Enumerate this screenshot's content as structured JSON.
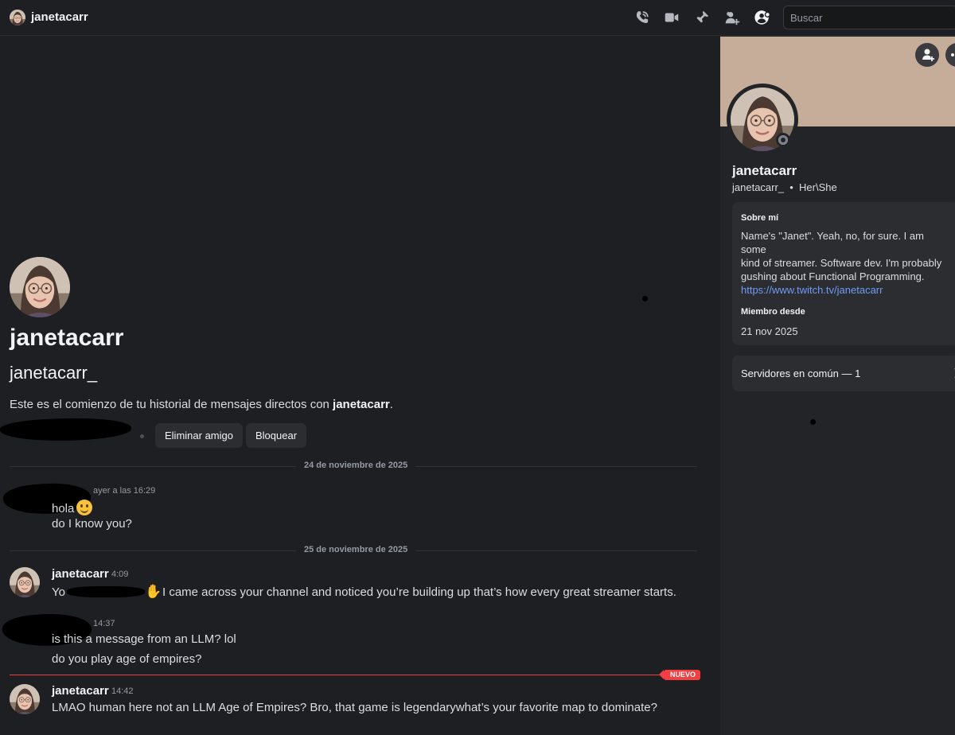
{
  "header": {
    "title": "janetacarr",
    "icons": [
      "phone-icon",
      "video-icon",
      "pin-icon",
      "add-friend-icon",
      "profile-toggle-icon"
    ],
    "search_placeholder": "Buscar"
  },
  "intro": {
    "display_name": "janetacarr",
    "username": "janetacarr_",
    "text_prefix": "Este es el comienzo de tu historial de mensajes directos con ",
    "text_name": "janetacarr",
    "text_suffix": ".",
    "remove_friend_label": "Eliminar amigo",
    "block_label": "Bloquear"
  },
  "dividers": [
    "24 de noviembre de 2025",
    "25 de noviembre de 2025"
  ],
  "messages": [
    {
      "author": "",
      "time": "ayer a las 16:29",
      "lines": [
        "hola",
        "do I know you?"
      ],
      "emoji": "slightly-smiling-face"
    },
    {
      "author": "janetacarr",
      "time": "4:09",
      "lines": [
        "Yo",
        "I came across your channel and noticed you’re building up  that’s how every great streamer starts."
      ],
      "emoji": "waving-hand"
    },
    {
      "author": "",
      "time": "14:37",
      "lines": [
        "is this a message from an LLM? lol",
        "do you play age of empires?"
      ]
    },
    {
      "author": "janetacarr",
      "time": "14:42",
      "lines": [
        "LMAO human here not an LLM  Age of Empires? Bro, that game is legendarywhat’s your favorite map to dominate?"
      ]
    }
  ],
  "new_badge": "NUEVO",
  "profile": {
    "banner_color": "#c6ad99",
    "display_name": "janetacarr",
    "handle": "janetacarr_",
    "pronouns": "Her\\She",
    "about_label": "Sobre mí",
    "about_lines": [
      "Name's \"Janet\". Yeah, no, for sure. I am some",
      "kind of streamer. Software dev. I'm probably",
      "gushing about Functional Programming."
    ],
    "link": "https://www.twitch.tv/janetacarr",
    "member_since_label": "Miembro desde",
    "member_since": "21 nov 2025",
    "mutual_servers": "Servidores en común — 1",
    "status": "offline"
  },
  "colors": {
    "accent": "#f23f43",
    "link": "#6f9bf6",
    "background": "#1e1f22",
    "panel": "#232428"
  }
}
